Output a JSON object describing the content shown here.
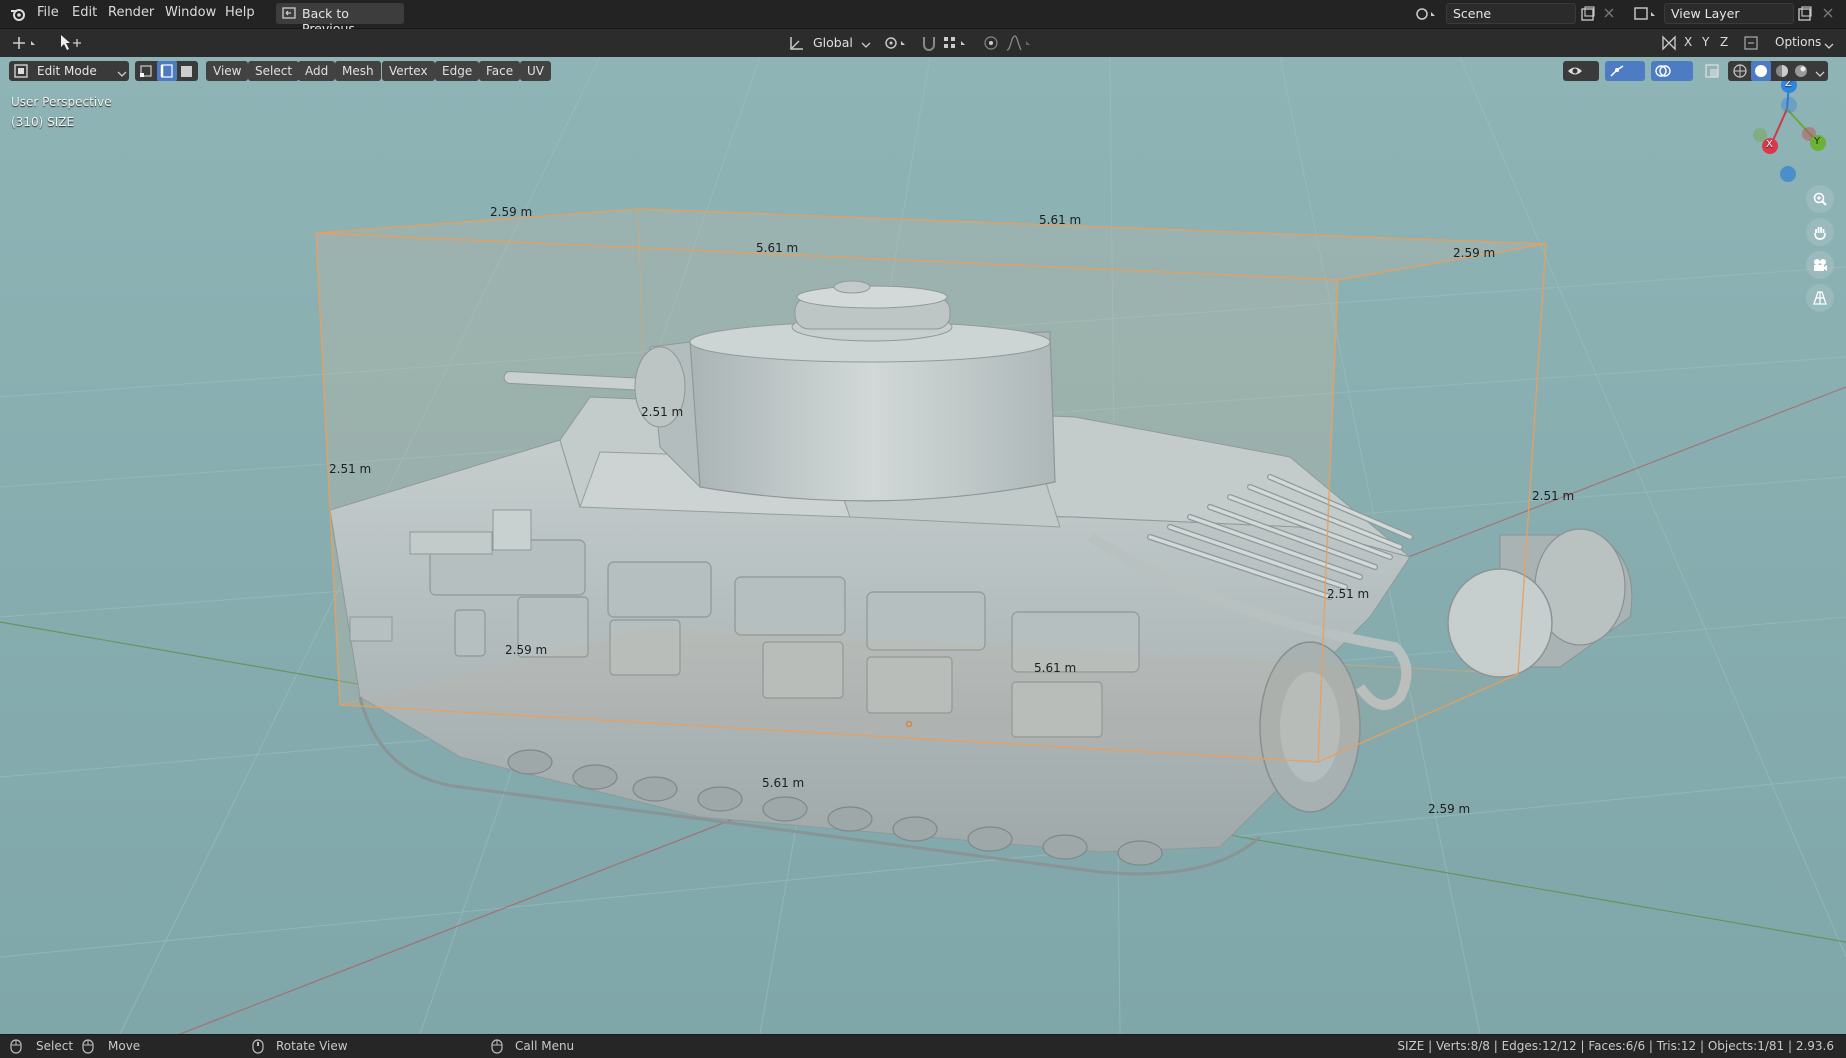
{
  "menu": {
    "file": "File",
    "edit": "Edit",
    "render": "Render",
    "window": "Window",
    "help": "Help",
    "back": "Back to Previous"
  },
  "topright": {
    "scene": "Scene",
    "view_layer": "View Layer"
  },
  "toolbar": {
    "transform_orientation": "Global",
    "options": "Options",
    "x": "X",
    "y": "Y",
    "z": "Z"
  },
  "header": {
    "mode": "Edit Mode",
    "view": "View",
    "select": "Select",
    "add": "Add",
    "mesh": "Mesh",
    "vertex": "Vertex",
    "edge": "Edge",
    "face": "Face",
    "uv": "UV"
  },
  "viewport": {
    "perspective": "User Perspective",
    "object_info": "(310) SIZE",
    "dimensions": {
      "d1": "2.59 m",
      "d2": "5.61 m",
      "d3": "5.61 m",
      "d4": "2.59 m",
      "d5": "2.51 m",
      "d6": "2.51 m",
      "d7": "2.51 m",
      "d8": "2.51 m",
      "d9": "2.59 m",
      "d10": "5.61 m",
      "d11": "5.61 m",
      "d12": "2.59 m"
    }
  },
  "gizmo": {
    "x": "X",
    "y": "Y",
    "z": "Z"
  },
  "status": {
    "select": "Select",
    "move": "Move",
    "rotate": "Rotate View",
    "call_menu": "Call Menu",
    "stats": "SIZE | Verts:8/8 | Edges:12/12 | Faces:6/6 | Tris:12 | Objects:1/81 | 2.93.6"
  },
  "colors": {
    "viewport_bg": "#86adb0",
    "selection": "#e8a060",
    "mesh": "#b9c2c2"
  }
}
